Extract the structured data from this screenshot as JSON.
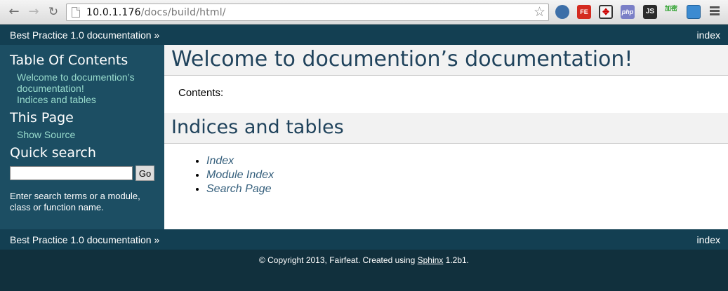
{
  "browser": {
    "url_host": "10.0.1.176",
    "url_path": "/docs/build/html/",
    "extensions": [
      {
        "icon": "globe-extension-icon",
        "label": ""
      },
      {
        "icon": "fe-extension-icon",
        "label": "FE"
      },
      {
        "icon": "target-extension-icon",
        "label": "✥"
      },
      {
        "icon": "php-extension-icon",
        "label": "php"
      },
      {
        "icon": "js-extension-icon",
        "label": "JS"
      },
      {
        "icon": "encrypt-extension-icon",
        "label": "加密"
      },
      {
        "icon": "screen-extension-icon",
        "label": ""
      }
    ]
  },
  "related_top": {
    "home_label": "Best Practice 1.0 documentation »",
    "index_label": "index"
  },
  "sidebar": {
    "toc_title": "Table Of Contents",
    "toc_links": [
      "Welcome to documention’s documentation!",
      "Indices and tables"
    ],
    "this_page_title": "This Page",
    "show_source": "Show Source",
    "quick_search_title": "Quick search",
    "go_label": "Go",
    "search_help": "Enter search terms or a module, class or function name."
  },
  "main": {
    "title": "Welcome to documention’s documentation!",
    "contents_label": "Contents:",
    "indices_title": "Indices and tables",
    "index_items": [
      "Index",
      "Module Index",
      "Search Page"
    ]
  },
  "related_bottom": {
    "home_label": "Best Practice 1.0 documentation »",
    "index_label": "index"
  },
  "footer": {
    "copyright_prefix": "© Copyright 2013, Fairfeat. Created using ",
    "sphinx_link": "Sphinx",
    "version": " 1.2b1."
  }
}
